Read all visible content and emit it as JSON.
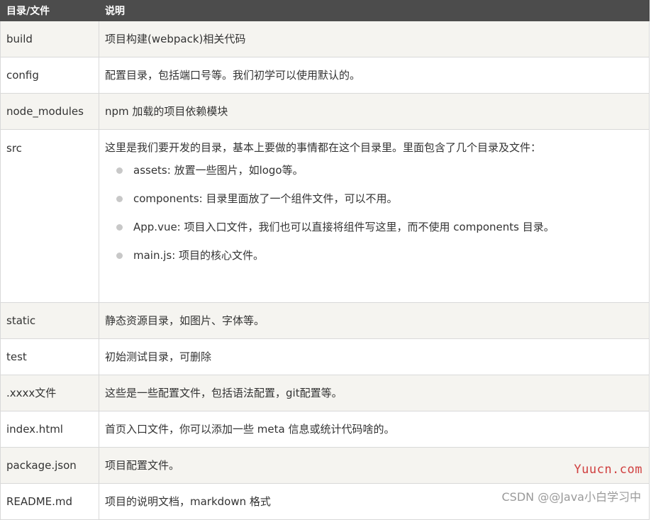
{
  "table": {
    "headers": {
      "name": "目录/文件",
      "desc": "说明"
    },
    "rows": [
      {
        "name": "build",
        "desc": "项目构建(webpack)相关代码"
      },
      {
        "name": "config",
        "desc": "配置目录，包括端口号等。我们初学可以使用默认的。"
      },
      {
        "name": "node_modules",
        "desc": "npm 加载的项目依赖模块"
      },
      {
        "name": "src",
        "desc": "这里是我们要开发的目录，基本上要做的事情都在这个目录里。里面包含了几个目录及文件：",
        "items": [
          "assets: 放置一些图片，如logo等。",
          "components: 目录里面放了一个组件文件，可以不用。",
          "App.vue: 项目入口文件，我们也可以直接将组件写这里，而不使用 components 目录。",
          "main.js: 项目的核心文件。"
        ]
      },
      {
        "name": "static",
        "desc": "静态资源目录，如图片、字体等。"
      },
      {
        "name": "test",
        "desc": "初始测试目录，可删除"
      },
      {
        "name": ".xxxx文件",
        "desc": "这些是一些配置文件，包括语法配置，git配置等。"
      },
      {
        "name": "index.html",
        "desc": "首页入口文件，你可以添加一些 meta 信息或统计代码啥的。"
      },
      {
        "name": "package.json",
        "desc": "项目配置文件。"
      },
      {
        "name": "README.md",
        "desc": "项目的说明文档，markdown 格式"
      }
    ]
  },
  "watermarks": {
    "site": "Yuucn.com",
    "csdn": "CSDN @@Java小白学习中"
  }
}
